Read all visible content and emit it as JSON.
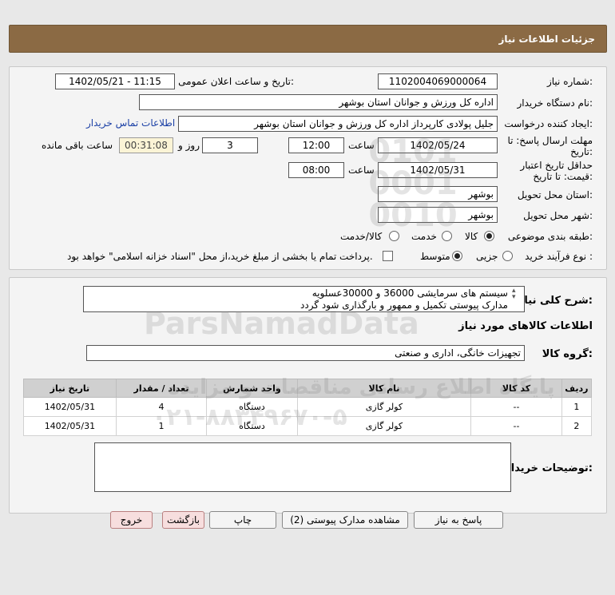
{
  "header": {
    "title": "جزئیات اطلاعات نیاز"
  },
  "form": {
    "need_number_label": "شماره نیاز:",
    "need_number": "1102004069000064",
    "announce_label": "تاریخ و ساعت اعلان عمومی:",
    "announce_value": "1402/05/21 - 11:15",
    "buyer_org_label": "نام دستگاه خریدار:",
    "buyer_org": "اداره کل ورزش و جوانان استان بوشهر",
    "requester_label": "ایجاد کننده درخواست:",
    "requester": "جلیل پولادی کارپرداز اداره کل ورزش و جوانان استان بوشهر",
    "contact_link": "اطلاعات تماس خریدار",
    "deadline_label_1": "مهلت ارسال پاسخ: تا",
    "deadline_label_2": "تاریخ:",
    "deadline_date": "1402/05/24",
    "time_label": "ساعت",
    "deadline_time": "12:00",
    "days_value": "3",
    "days_label": "روز و",
    "remaining_time": "00:31:08",
    "remaining_label": "ساعت باقی مانده",
    "validity_label_1": "حداقل تاریخ اعتبار",
    "validity_label_2": "قیمت: تا تاریخ:",
    "validity_date": "1402/05/31",
    "validity_time_label": "ساعت",
    "validity_time": "08:00",
    "province_label": "استان محل تحویل:",
    "province": "بوشهر",
    "city_label": "شهر محل تحویل:",
    "city": "بوشهر",
    "category_label": "طبقه بندی موضوعی:",
    "category_options": [
      "کالا",
      "خدمت",
      "کالا/خدمت"
    ],
    "process_label": "نوع فرآیند خرید :",
    "process_options": [
      "جزیی",
      "متوسط"
    ],
    "payment_note": "پرداخت تمام یا بخشی از مبلغ خرید،از محل \"اسناد خزانه اسلامی\" خواهد بود."
  },
  "description": {
    "label": "شرح کلی نیاز:",
    "line1": "سیستم های سرمایشی 36000 و 30000عسلویه",
    "line2": "مدارک پیوستی تکمیل و ممهور و بارگذاری شود گردد"
  },
  "goods": {
    "section_title": "اطلاعات کالاهای مورد نیاز",
    "group_label": "گروه کالا:",
    "group_value": "تجهیزات خانگی، اداری و صنعتی",
    "columns": [
      "ردیف",
      "کد کالا",
      "نام کالا",
      "واحد شمارش",
      "تعداد / مقدار",
      "تاریخ نیاز"
    ],
    "rows": [
      [
        "1",
        "--",
        "کولر گازی",
        "دستگاه",
        "4",
        "1402/05/31"
      ],
      [
        "2",
        "--",
        "کولر گازی",
        "دستگاه",
        "1",
        "1402/05/31"
      ]
    ]
  },
  "buyer_notes": {
    "label": "توضیحات خریدار:",
    "value": ""
  },
  "buttons": {
    "reply": "پاسخ به نیاز",
    "attachments": "مشاهده مدارک پیوستی (2)",
    "print": "چاپ",
    "back": "بازگشت",
    "exit": "خروج"
  },
  "watermark": {
    "brand": "ParsNamadData",
    "line_fa": "پایگاه اطلاع رسانی مناقصات و مزایده",
    "phone": "۰۲۱-۸۸۳۴۹۶۷۰-۵",
    "digits": "0101 0001 0010"
  }
}
